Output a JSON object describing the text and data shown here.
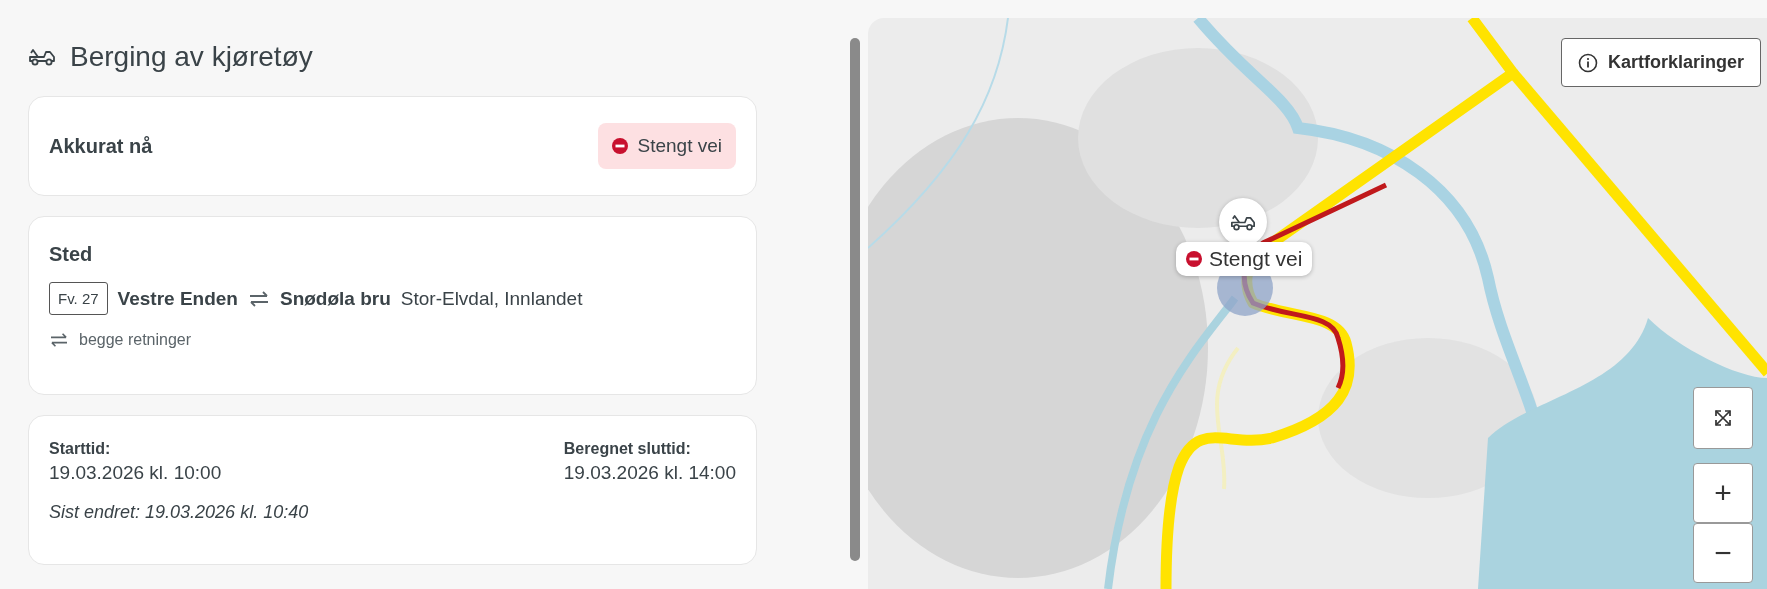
{
  "title": "Berging av kjøretøy",
  "status_card": {
    "label": "Akkurat nå",
    "badge": "Stengt vei"
  },
  "location": {
    "heading": "Sted",
    "road_number": "Fv. 27",
    "from": "Vestre Enden",
    "to": "Snødøla bru",
    "area": "Stor-Elvdal, Innlandet",
    "direction": "begge retninger"
  },
  "times": {
    "start_label": "Starttid:",
    "start": "19.03.2026 kl. 10:00",
    "end_label": "Beregnet sluttid:",
    "end": "19.03.2026 kl. 14:00",
    "changed": "Sist endret: 19.03.2026 kl. 10:40"
  },
  "map": {
    "legend_button": "Kartforklaringer",
    "marker_label": "Stengt vei",
    "zoom_in": "+",
    "zoom_out": "−"
  }
}
